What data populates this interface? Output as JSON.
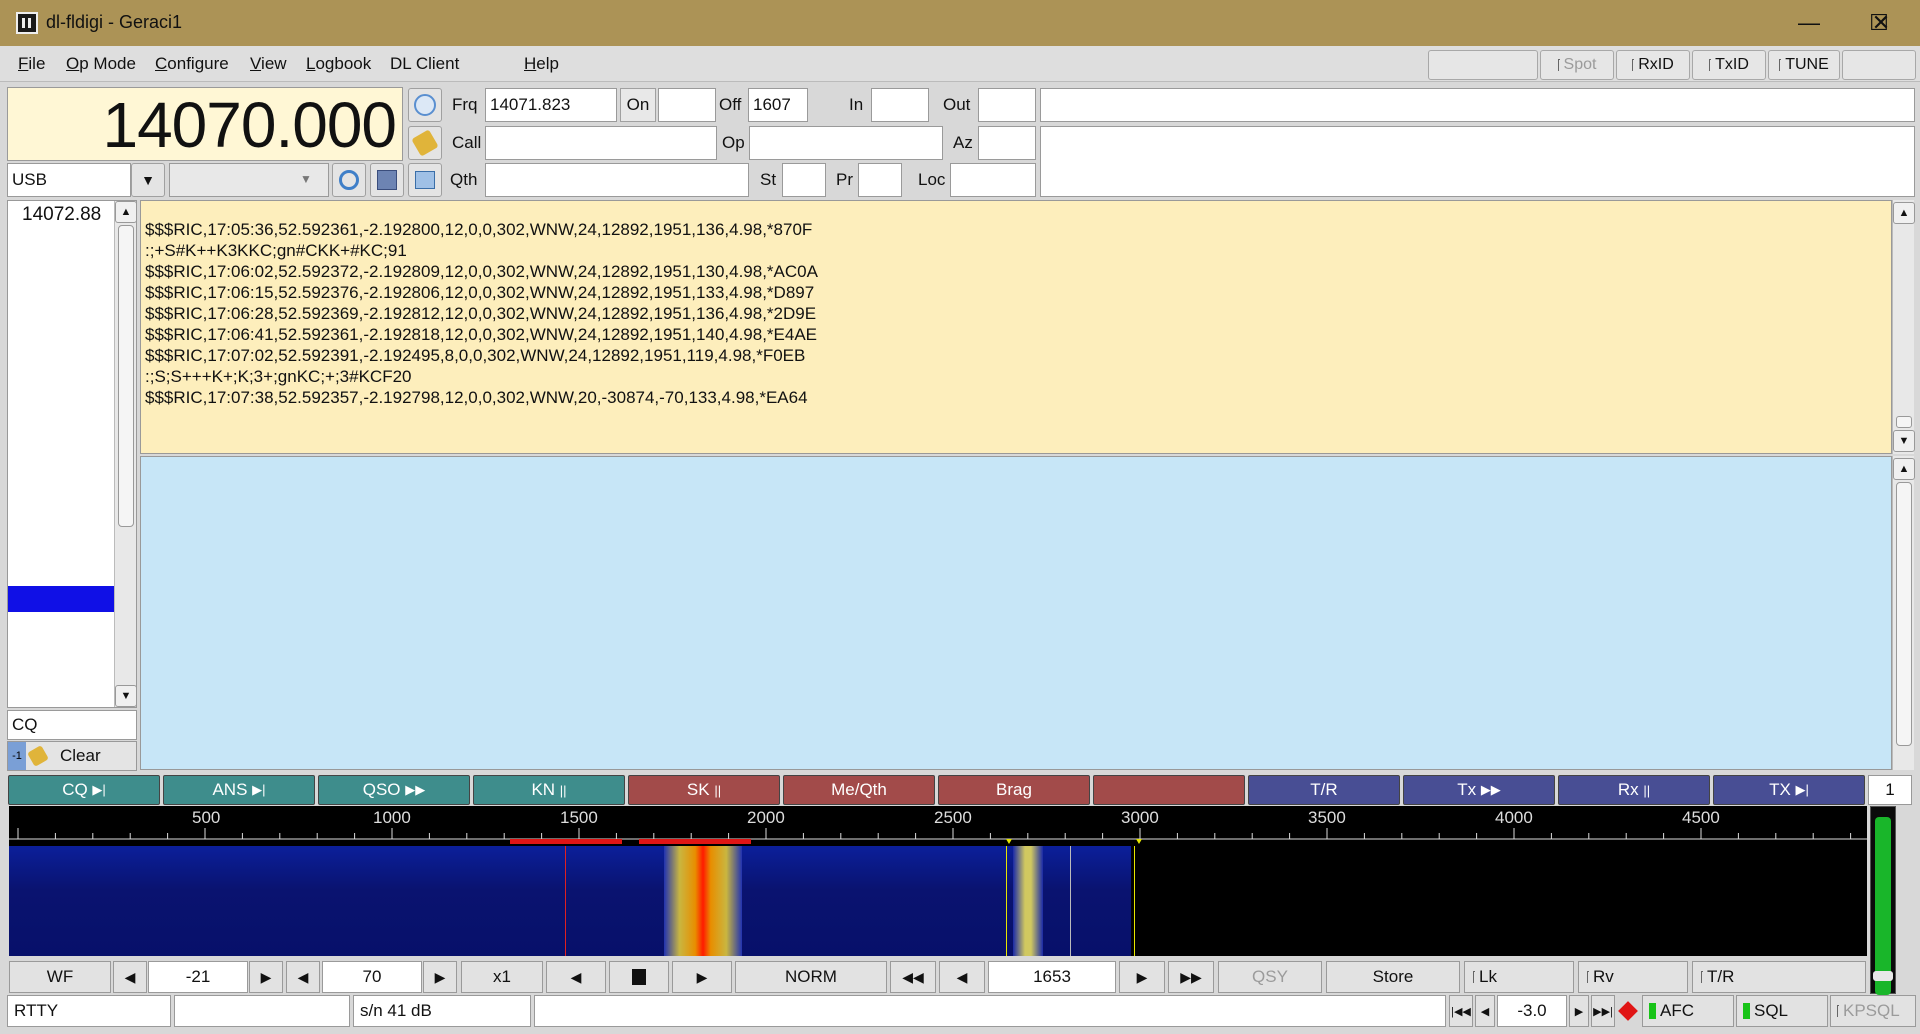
{
  "window": {
    "title": "dl-fldigi - Geraci1"
  },
  "menu": {
    "items": [
      {
        "label": "File",
        "u": "F",
        "rest": "ile"
      },
      {
        "label": "Op Mode",
        "u": "O",
        "rest": "p Mode"
      },
      {
        "label": "Configure",
        "u": "C",
        "rest": "onfigure"
      },
      {
        "label": "View",
        "u": "V",
        "rest": "iew"
      },
      {
        "label": "Logbook",
        "u": "L",
        "rest": "ogbook"
      },
      {
        "label": "DL Client",
        "u": "",
        "rest": "DL Client"
      },
      {
        "label": "Help",
        "u": "H",
        "rest": "elp"
      }
    ],
    "spot": "Spot",
    "rxid": "RxID",
    "txid": "TxID",
    "tune": "TUNE"
  },
  "freq": {
    "dial": "14070.000",
    "mode": "USB",
    "frq_label": "Frq",
    "frq_value": "14071.823",
    "on_label": "On",
    "on_value": "",
    "off_label": "Off",
    "off_value": "1607",
    "in_label": "In",
    "in_value": "",
    "out_label": "Out",
    "out_value": "",
    "call_label": "Call",
    "call_value": "",
    "op_label": "Op",
    "op_value": "",
    "az_label": "Az",
    "az_value": "",
    "qth_label": "Qth",
    "qth_value": "",
    "st_label": "St",
    "st_value": "",
    "pr_label": "Pr",
    "pr_value": "",
    "loc_label": "Loc",
    "loc_value": ""
  },
  "left": {
    "freq_item": "14072.88",
    "search_value": "CQ",
    "clear_label": "Clear",
    "mini": "-1"
  },
  "rx_text": "$$$RIC,17:05:36,52.592361,-2.192800,12,0,0,302,WNW,24,12892,1951,136,4.98,*870F\n:;+S#K++K3KKC;gn#CKK+#KC;91\n$$$RIC,17:06:02,52.592372,-2.192809,12,0,0,302,WNW,24,12892,1951,130,4.98,*AC0A\n$$$RIC,17:06:15,52.592376,-2.192806,12,0,0,302,WNW,24,12892,1951,133,4.98,*D897\n$$$RIC,17:06:28,52.592369,-2.192812,12,0,0,302,WNW,24,12892,1951,136,4.98,*2D9E\n$$$RIC,17:06:41,52.592361,-2.192818,12,0,0,302,WNW,24,12892,1951,140,4.98,*E4AE\n$$$RIC,17:07:02,52.592391,-2.192495,8,0,0,302,WNW,24,12892,1951,119,4.98,*F0EB\n:;S;S+++K+;K;3+;gnKC;+;3#KCF20\n$$$RIC,17:07:38,52.592357,-2.192798,12,0,0,302,WNW,20,-30874,-70,133,4.98,*EA64",
  "macros": [
    {
      "label": "CQ",
      "glyph": "▶|",
      "color": "#3e8d8c"
    },
    {
      "label": "ANS",
      "glyph": "▶|",
      "color": "#3e8d8c"
    },
    {
      "label": "QSO",
      "glyph": "▶▶",
      "color": "#3e8d8c"
    },
    {
      "label": "KN",
      "glyph": "||",
      "color": "#3e8d8c"
    },
    {
      "label": "SK",
      "glyph": "||",
      "color": "#a24b4a"
    },
    {
      "label": "Me/Qth",
      "glyph": "",
      "color": "#a24b4a"
    },
    {
      "label": "Brag",
      "glyph": "",
      "color": "#a24b4a"
    },
    {
      "label": "",
      "glyph": "",
      "color": "#a24b4a"
    },
    {
      "label": "T/R",
      "glyph": "",
      "color": "#484e94"
    },
    {
      "label": "Tx",
      "glyph": "▶▶",
      "color": "#484e94"
    },
    {
      "label": "Rx",
      "glyph": "||",
      "color": "#484e94"
    },
    {
      "label": "TX",
      "glyph": "▶|",
      "color": "#484e94"
    }
  ],
  "macro_page": "1",
  "scale": {
    "ticks": [
      "500",
      "1000",
      "1500",
      "2000",
      "2500",
      "3000",
      "3500",
      "4000",
      "4500"
    ]
  },
  "wf_controls": {
    "wf": "WF",
    "level": "-21",
    "range": "70",
    "zoom": "x1",
    "norm": "NORM",
    "carrier": "1653",
    "qsy": "QSY",
    "store": "Store",
    "lk": "Lk",
    "rv": "Rv",
    "tr": "T/R"
  },
  "status": {
    "mode": "RTTY",
    "blank": "",
    "snr": "s/n 41  dB",
    "afc_value": "-3.0",
    "afc": "AFC",
    "sql": "SQL",
    "kpsql": "KPSQL"
  },
  "colors": {
    "rx_bg": "#fdeebc",
    "tx_bg": "#c7e6f7",
    "freq_bg": "#fff7d5",
    "led": "#18c418"
  }
}
